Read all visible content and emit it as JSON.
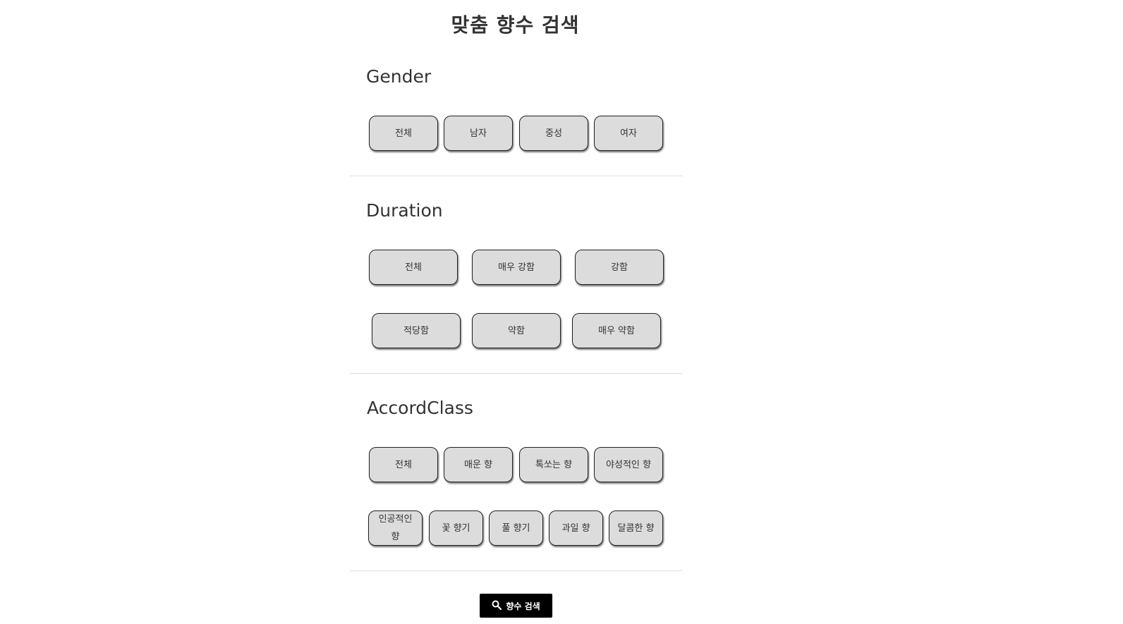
{
  "page": {
    "title": "맞춤 향수 검색"
  },
  "gender": {
    "heading": "Gender",
    "options": [
      "전체",
      "남자",
      "중성",
      "여자"
    ]
  },
  "duration": {
    "heading": "Duration",
    "options": [
      "전체",
      "매우 강함",
      "강함",
      "적당함",
      "약함",
      "매우 약함"
    ]
  },
  "accord": {
    "heading": "AccordClass",
    "options": [
      "전체",
      "매운 향",
      "톡쏘는 향",
      "야성적인 향",
      "인공적인 향",
      "꽃 향기",
      "풀 향기",
      "과일 향",
      "달콤한 향"
    ]
  },
  "search": {
    "label": "향수 검색",
    "icon": "search-icon"
  },
  "colors": {
    "button_bg": "#dcdcdc",
    "search_bg": "#000000",
    "text": "#333333"
  }
}
